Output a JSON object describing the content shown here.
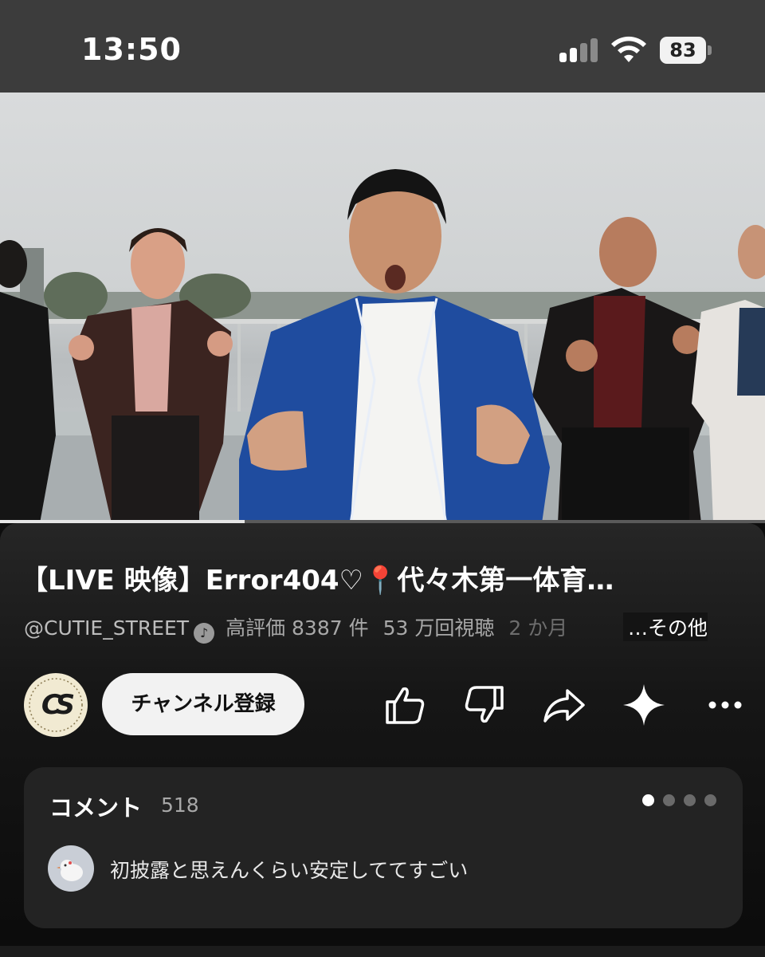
{
  "status_bar": {
    "time": "13:50",
    "battery": "83"
  },
  "video": {
    "progress": 0.32
  },
  "title": "【LIVE 映像】Error404♡📍代々木第一体育…",
  "meta": {
    "handle": "@CUTIE_STREET",
    "likes": "高評価 8387 件",
    "views": "53 万回視聴",
    "age_partial": "2 か月",
    "more": "…その他"
  },
  "channel": {
    "avatar_text": "CS",
    "subscribe_label": "チャンネル登録"
  },
  "actions": [
    "like-icon",
    "dislike-icon",
    "share-icon",
    "sparkle-icon",
    "more-icon"
  ],
  "comments": {
    "label": "コメント",
    "count": "518",
    "text": "初披露と思えんくらい安定しててすごい",
    "page_dots": 4,
    "active_dot": 1
  },
  "colors": {
    "status_bar": "#3c3c3c",
    "panel": "#161616",
    "comment_card": "#232323",
    "subscribe": "#f2f2f2"
  }
}
